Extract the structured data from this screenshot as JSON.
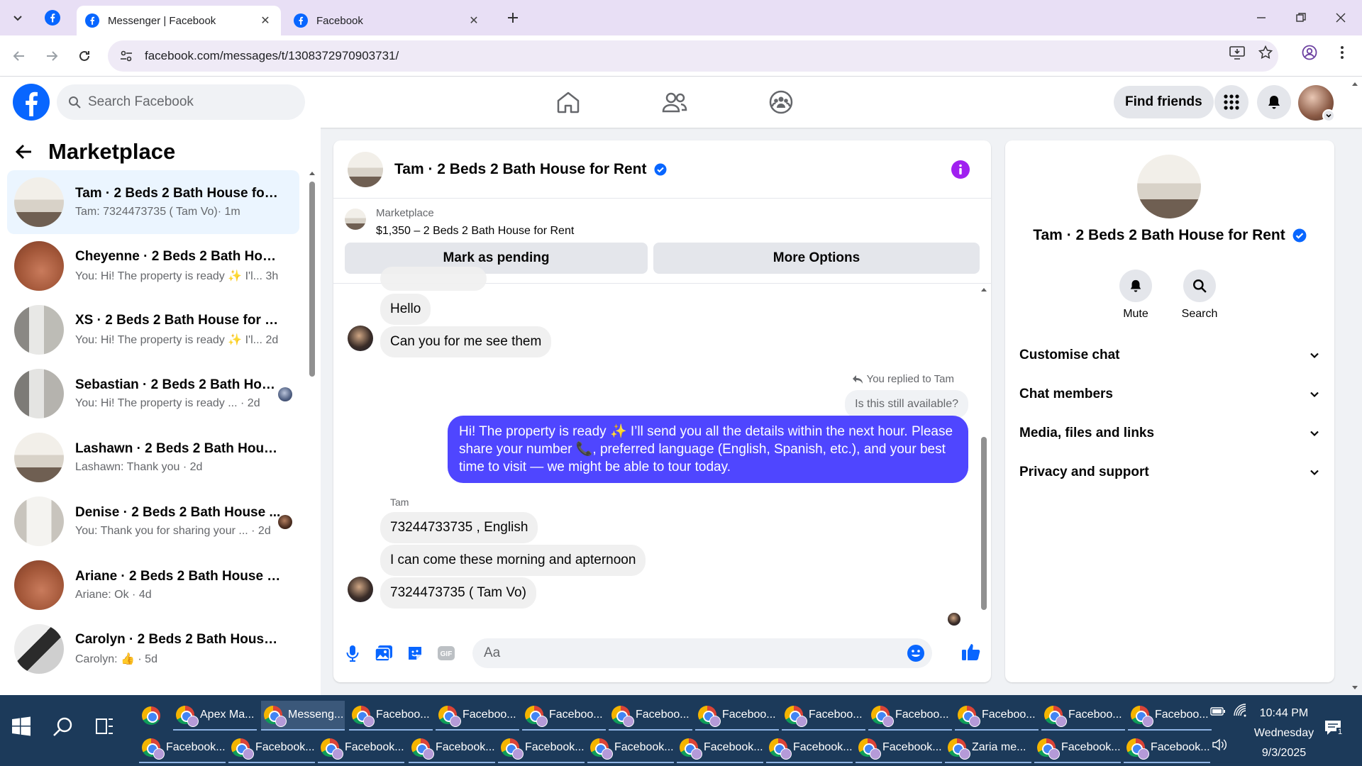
{
  "browser": {
    "tabs": [
      {
        "title": "Messenger | Facebook",
        "active": true
      },
      {
        "title": "Facebook",
        "active": false
      }
    ],
    "url": "facebook.com/messages/t/1308372970903731/"
  },
  "header": {
    "search_placeholder": "Search Facebook",
    "find_friends": "Find friends"
  },
  "sidebar": {
    "title": "Marketplace",
    "conversations": [
      {
        "name": "Tam · 2 Beds 2 Bath House for R...",
        "preview": "Tam: 7324473735 ( Tam Vo)",
        "time": "· 1m",
        "active": true
      },
      {
        "name": "Cheyenne · 2 Beds 2 Bath House...",
        "preview": "You: Hi! The property is ready ✨ I'l...",
        "time": "3h"
      },
      {
        "name": "XS · 2 Beds 2 Bath House for Rent",
        "preview": "You: Hi! The property is ready ✨ I'l...",
        "time": "2d"
      },
      {
        "name": "Sebastian · 2 Beds 2 Bath Hou...",
        "preview": "You: Hi! The property is ready ...",
        "time": "· 2d"
      },
      {
        "name": "Lashawn · 2 Beds 2 Bath House f...",
        "preview": "Lashawn: Thank you",
        "time": "· 2d"
      },
      {
        "name": "Denise · 2 Beds 2 Bath House ...",
        "preview": "You: Thank you for sharing your ...",
        "time": "· 2d"
      },
      {
        "name": "Ariane · 2 Beds 2 Bath House for...",
        "preview": "Ariane: Ok",
        "time": "· 4d"
      },
      {
        "name": "Carolyn · 2 Beds 2 Bath House f...",
        "preview": "Carolyn: 👍",
        "time": "· 5d"
      }
    ]
  },
  "chat": {
    "title": "Tam · 2 Beds 2 Bath House for Rent",
    "listing": {
      "category": "Marketplace",
      "price_title": "$1,350 – 2 Beds 2 Bath House for Rent",
      "mark_pending": "Mark as pending",
      "more_options": "More Options"
    },
    "messages": {
      "m1": "Hello",
      "m2": "Can you for me see them",
      "reply_note": "You replied to Tam",
      "reply_quote": "Is this still available?",
      "mine": "Hi! The property is ready ✨ I’ll send you all the details within the next hour. Please share your number 📞, preferred language (English, Spanish, etc.), and your best time to visit — we might be able to tour today.",
      "sender": "Tam",
      "m3": "73244733735 , English",
      "m4": "I can come these morning and apternoon",
      "m5": "7324473735 ( Tam Vo)"
    },
    "composer_placeholder": "Aa"
  },
  "details": {
    "name": "Tam · 2 Beds 2 Bath House for Rent",
    "mute": "Mute",
    "search": "Search",
    "sections": [
      "Customise chat",
      "Chat members",
      "Media, files and links",
      "Privacy and support"
    ]
  },
  "taskbar": {
    "row1": [
      "Apex Ma...",
      "Messeng...",
      "Faceboo...",
      "Faceboo...",
      "Faceboo...",
      "Faceboo...",
      "Faceboo...",
      "Faceboo...",
      "Faceboo...",
      "Faceboo...",
      "Faceboo...",
      "Faceboo..."
    ],
    "row2": [
      "Facebook...",
      "Facebook...",
      "Facebook...",
      "Facebook...",
      "Facebook...",
      "Facebook...",
      "Facebook...",
      "Facebook...",
      "Facebook...",
      "Zaria me...",
      "Facebook...",
      "Facebook..."
    ],
    "time": "10:44 PM",
    "day": "Wednesday",
    "date": "9/3/2025",
    "notifications": "1"
  },
  "colors": {
    "fb_blue": "#0866ff",
    "my_bubble": "#4f46ff",
    "info_purple": "#a020f0"
  }
}
